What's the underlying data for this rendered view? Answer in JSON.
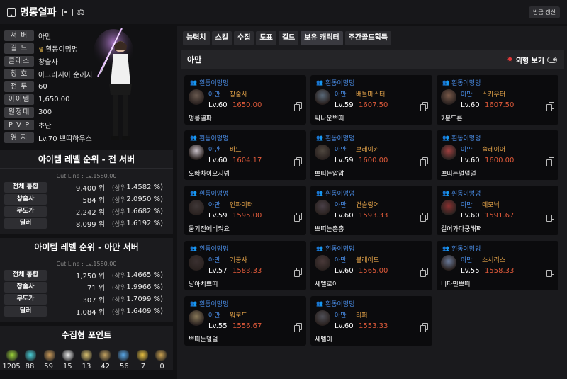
{
  "header": {
    "name": "멍롱열파",
    "refresh_label": "방금 갱신"
  },
  "profile": {
    "rows": [
      {
        "label": "서 버",
        "value": "아만"
      },
      {
        "label": "길 드",
        "value": "흰동이멍멍"
      },
      {
        "label": "클래스",
        "value": "창술사"
      },
      {
        "label": "칭 호",
        "value": "아크라시아 순례자"
      },
      {
        "label": "전 투",
        "value": "60"
      },
      {
        "label": "아이템",
        "value": "1,650.00"
      },
      {
        "label": "원정대",
        "value": "300"
      },
      {
        "label": "P V P",
        "value": "초단"
      },
      {
        "label": "영 지",
        "value": "Lv.70 쁘띠하우스"
      }
    ]
  },
  "rank_all": {
    "title": "아이템 레벨 순위 - 전 서버",
    "cutline": "Cut Line : Lv.1580.00",
    "rows": [
      {
        "label": "전체 통합",
        "value": "9,400 위",
        "top": "(상위",
        "pct": "1.4582 %)"
      },
      {
        "label": "창술사",
        "value": "584 위",
        "top": "(상위",
        "pct": "2.0950 %)"
      },
      {
        "label": "무도가",
        "value": "2,242 위",
        "top": "(상위",
        "pct": "1.6682 %)"
      },
      {
        "label": "딜러",
        "value": "8,099 위",
        "top": "(상위",
        "pct": "1.6192 %)"
      }
    ]
  },
  "rank_server": {
    "title": "아이템 레벨 순위 - 아만 서버",
    "cutline": "Cut Line : Lv.1580.00",
    "rows": [
      {
        "label": "전체 통합",
        "value": "1,250 위",
        "top": "(상위",
        "pct": "1.4665 %)"
      },
      {
        "label": "창술사",
        "value": "71 위",
        "top": "(상위",
        "pct": "1.9966 %)"
      },
      {
        "label": "무도가",
        "value": "307 위",
        "top": "(상위",
        "pct": "1.7099 %)"
      },
      {
        "label": "딜러",
        "value": "1,084 위",
        "top": "(상위",
        "pct": "1.6409 %)"
      }
    ]
  },
  "collect": {
    "title": "수집형 포인트",
    "icons": [
      "seed-icon",
      "island-icon",
      "map-icon",
      "heart-icon",
      "statue-icon",
      "art-icon",
      "leaf-icon",
      "star-icon",
      "medal-icon"
    ],
    "colors": [
      "#9bd13a",
      "#4ad0d8",
      "#c89a5a",
      "#e8e8e8",
      "#d8c070",
      "#c0a060",
      "#5aa8e8",
      "#e8c040",
      "#c8a050"
    ],
    "values": [
      "1205",
      "88",
      "59",
      "15",
      "13",
      "42",
      "56",
      "7",
      "0"
    ]
  },
  "tabs": [
    "능력치",
    "스킬",
    "수집",
    "도표",
    "길드",
    "보유 캐릭터",
    "주간골드획득"
  ],
  "server_head": {
    "name": "아만",
    "appearance_label": "외형 보기"
  },
  "characters": [
    {
      "guild": "흰동이멍멍",
      "server": "아만",
      "cls": "창술사",
      "lv": "Lv.60",
      "ilvl": "1650.00",
      "name": "멍롱열파"
    },
    {
      "guild": "흰동이멍멍",
      "server": "아만",
      "cls": "배틀마스터",
      "lv": "Lv.59",
      "ilvl": "1607.50",
      "name": "싸나운쁘띠"
    },
    {
      "guild": "흰동이멍멍",
      "server": "아만",
      "cls": "스카우터",
      "lv": "Lv.60",
      "ilvl": "1607.50",
      "name": "7분드론"
    },
    {
      "guild": "흰동이멍멍",
      "server": "아만",
      "cls": "바드",
      "lv": "Lv.60",
      "ilvl": "1604.17",
      "name": "오빠차이오지넹"
    },
    {
      "guild": "흰동이멍멍",
      "server": "아만",
      "cls": "브레이커",
      "lv": "Lv.59",
      "ilvl": "1600.00",
      "name": "쁘띠는압맙"
    },
    {
      "guild": "흰동이멍멍",
      "server": "아만",
      "cls": "슬레이어",
      "lv": "Lv.60",
      "ilvl": "1600.00",
      "name": "쁘띠는덜덜덜"
    },
    {
      "guild": "흰동이멍멍",
      "server": "아만",
      "cls": "인파이터",
      "lv": "Lv.59",
      "ilvl": "1595.00",
      "name": "물기전에비켜요"
    },
    {
      "guild": "흰동이멍멍",
      "server": "아만",
      "cls": "건슬링어",
      "lv": "Lv.60",
      "ilvl": "1593.33",
      "name": "쁘띠는총총"
    },
    {
      "guild": "흰동이멍멍",
      "server": "아만",
      "cls": "데모닉",
      "lv": "Lv.60",
      "ilvl": "1591.67",
      "name": "걸어가다쿵해쩌"
    },
    {
      "guild": "흰동이멍멍",
      "server": "아만",
      "cls": "기공사",
      "lv": "Lv.57",
      "ilvl": "1583.33",
      "name": "냥아치쁘띠"
    },
    {
      "guild": "흰동이멍멍",
      "server": "아만",
      "cls": "블레이드",
      "lv": "Lv.60",
      "ilvl": "1565.00",
      "name": "세멜로이"
    },
    {
      "guild": "흰동이멍멍",
      "server": "아만",
      "cls": "소서리스",
      "lv": "Lv.55",
      "ilvl": "1558.33",
      "name": "비타민쁘띠"
    },
    {
      "guild": "흰동이멍멍",
      "server": "아만",
      "cls": "워로드",
      "lv": "Lv.55",
      "ilvl": "1556.67",
      "name": "쁘띠는덜덜"
    },
    {
      "guild": "흰동이멍멍",
      "server": "아만",
      "cls": "리퍼",
      "lv": "Lv.60",
      "ilvl": "1553.33",
      "name": "세멜이"
    }
  ]
}
